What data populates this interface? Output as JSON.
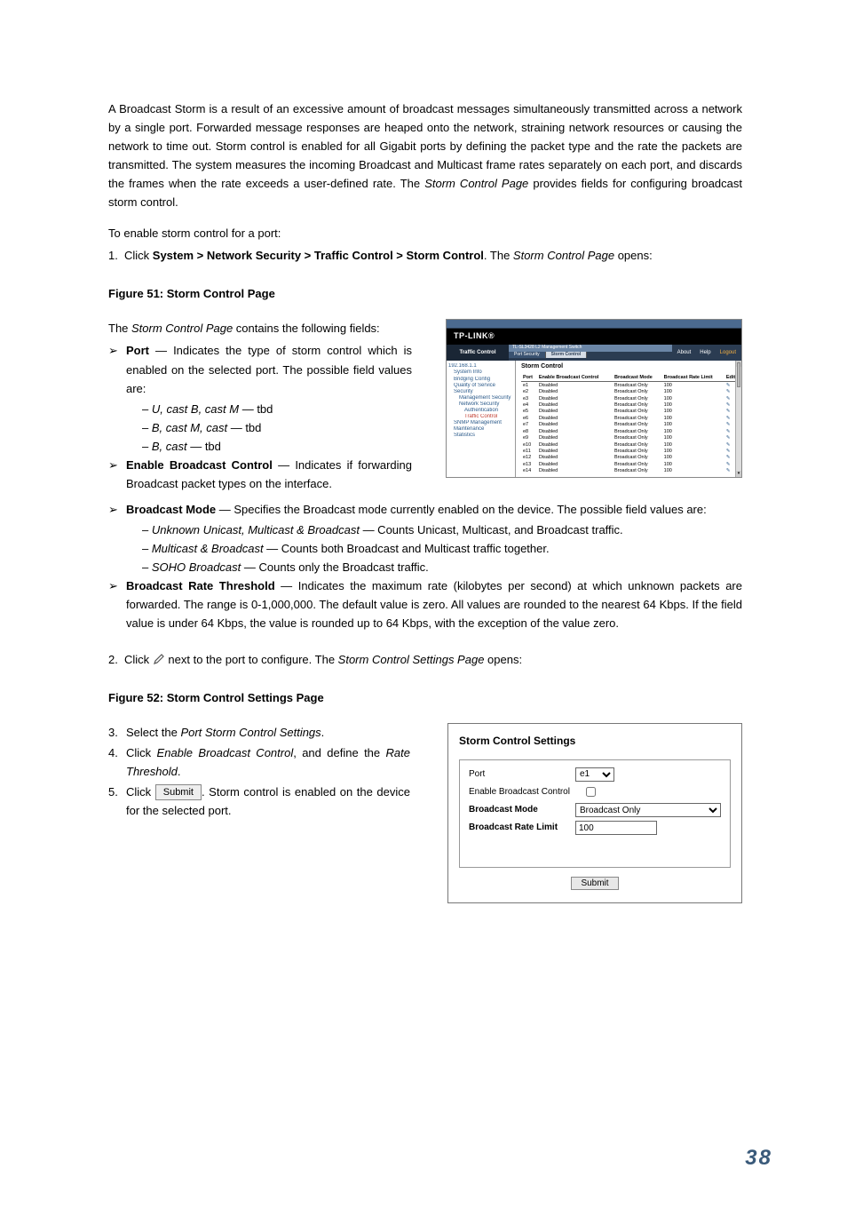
{
  "intro": "A Broadcast Storm is a result of an excessive amount of broadcast messages simultaneously transmitted across a network by a single port. Forwarded message responses are heaped onto the network, straining network resources or causing the network to time out. Storm control is enabled for all Gigabit ports by defining the packet type and the rate the packets are transmitted. The system measures the incoming Broadcast and Multicast frame rates separately on each port, and discards the frames when the rate exceeds a user-defined rate. The ",
  "intro_em": "Storm Control Page",
  "intro_tail": " provides fields for configuring broadcast storm control.",
  "enable_lead": "To enable storm control for a port:",
  "step1_num": "1.",
  "step1_pre": "Click ",
  "step1_bold": "System > Network Security > Traffic Control > Storm Control",
  "step1_mid": ". The ",
  "step1_em": "Storm Control Page",
  "step1_tail": " opens:",
  "fig51_caption": "Figure 51: Storm Control Page",
  "contains_pre": "The ",
  "contains_em": "Storm Control Page",
  "contains_tail": " contains the following fields:",
  "bullets": {
    "port": {
      "name": "Port",
      "desc": " — Indicates the type of storm control which is enabled on the selected port. The possible field values are:"
    },
    "port_opts": [
      {
        "em": "U, cast B, cast M",
        "tail": " — tbd"
      },
      {
        "em": "B, cast M, cast",
        "tail": " — tbd"
      },
      {
        "em": "B, cast",
        "tail": " — tbd"
      }
    ],
    "ebc": {
      "name": "Enable Broadcast Control",
      "desc": " — Indicates if forwarding Broadcast packet types on the interface."
    },
    "bm": {
      "name": "Broadcast Mode",
      "desc": " — Specifies the Broadcast mode currently enabled on the device. The possible field values are:"
    },
    "bm_opts": [
      {
        "em": "Unknown Unicast, Multicast & Broadcast",
        "tail": " — Counts Unicast, Multicast, and Broadcast traffic."
      },
      {
        "em": "Multicast & Broadcast",
        "tail": " — Counts both Broadcast and Multicast traffic together."
      },
      {
        "em": "SOHO Broadcast",
        "tail": " — Counts only the Broadcast traffic."
      }
    ],
    "brt": {
      "name": "Broadcast Rate Threshold",
      "desc": " — Indicates the maximum rate (kilobytes per second) at which unknown packets are forwarded. The range is 0-1,000,000. The default value is zero. All values are rounded to the nearest 64 Kbps. If the field value is under 64 Kbps, the value is rounded up to 64 Kbps, with the exception of the value zero."
    }
  },
  "step2_num": "2.",
  "step2_pre": "Click  ",
  "step2_mid": "  next to the port to configure. The ",
  "step2_em": "Storm Control Settings Page",
  "step2_tail": " opens:",
  "fig52_caption": "Figure 52: Storm Control Settings Page",
  "steps_345": {
    "s3": {
      "num": "3.",
      "pre": "Select the ",
      "em": "Port Storm Control Settings",
      "tail": "."
    },
    "s4": {
      "num": "4.",
      "pre": "Click ",
      "em": "Enable Broadcast Control",
      "mid": ", and define the ",
      "em2": "Rate Threshold",
      "tail": "."
    },
    "s5": {
      "num": "5.",
      "pre": "Click ",
      "btn": "Submit",
      "tail": ". Storm control is enabled on the device for the selected port."
    }
  },
  "fig51": {
    "brand": "TP-LINK®",
    "section": "Traffic Control",
    "banner": "TL-SL3428 L2 Management Switch",
    "tabs": {
      "t1": "Port Security",
      "t2": "Storm Control"
    },
    "links": {
      "about": "About",
      "help": "Help",
      "logout": "Logout"
    },
    "tree": [
      "192.168.1.1",
      "System Info",
      "Bridging Config",
      "Quality of Service",
      "Security",
      "Management Security",
      "Network Security",
      "Authentication",
      "Traffic Control",
      "SNMP Management",
      "Maintenance",
      "Statistics"
    ],
    "heading": "Storm Control",
    "th": {
      "c1": "Port",
      "c2": "Enable Broadcast Control",
      "c3": "Broadcast Mode",
      "c4": "Broadcast Rate Limit",
      "c5": "Edit"
    },
    "rows": [
      {
        "p": "e1",
        "e": "Disabled",
        "m": "Broadcast Only",
        "r": "100"
      },
      {
        "p": "e2",
        "e": "Disabled",
        "m": "Broadcast Only",
        "r": "100"
      },
      {
        "p": "e3",
        "e": "Disabled",
        "m": "Broadcast Only",
        "r": "100"
      },
      {
        "p": "e4",
        "e": "Disabled",
        "m": "Broadcast Only",
        "r": "100"
      },
      {
        "p": "e5",
        "e": "Disabled",
        "m": "Broadcast Only",
        "r": "100"
      },
      {
        "p": "e6",
        "e": "Disabled",
        "m": "Broadcast Only",
        "r": "100"
      },
      {
        "p": "e7",
        "e": "Disabled",
        "m": "Broadcast Only",
        "r": "100"
      },
      {
        "p": "e8",
        "e": "Disabled",
        "m": "Broadcast Only",
        "r": "100"
      },
      {
        "p": "e9",
        "e": "Disabled",
        "m": "Broadcast Only",
        "r": "100"
      },
      {
        "p": "e10",
        "e": "Disabled",
        "m": "Broadcast Only",
        "r": "100"
      },
      {
        "p": "e11",
        "e": "Disabled",
        "m": "Broadcast Only",
        "r": "100"
      },
      {
        "p": "e12",
        "e": "Disabled",
        "m": "Broadcast Only",
        "r": "100"
      },
      {
        "p": "e13",
        "e": "Disabled",
        "m": "Broadcast Only",
        "r": "100"
      },
      {
        "p": "e14",
        "e": "Disabled",
        "m": "Broadcast Only",
        "r": "100"
      }
    ]
  },
  "fig52": {
    "title": "Storm Control Settings",
    "port_lbl": "Port",
    "port_val": "e1",
    "ebc_lbl": "Enable Broadcast Control",
    "bm_lbl": "Broadcast Mode",
    "bm_val": "Broadcast Only",
    "brl_lbl": "Broadcast Rate Limit",
    "brl_val": "100",
    "submit": "Submit"
  },
  "page_number": "38",
  "arrow": "➢",
  "dash": "–"
}
